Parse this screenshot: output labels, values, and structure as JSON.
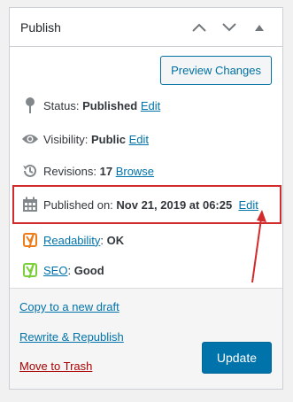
{
  "panel": {
    "title": "Publish",
    "move_up_glyph": "∧",
    "move_down_glyph": "∨",
    "toggle_glyph": "▲"
  },
  "preview_button": "Preview Changes",
  "status": {
    "label": "Status:",
    "value": "Published",
    "edit": "Edit",
    "icon": "pin-icon"
  },
  "visibility": {
    "label": "Visibility:",
    "value": "Public",
    "edit": "Edit",
    "icon": "eye-icon"
  },
  "revisions": {
    "label": "Revisions:",
    "value": "17",
    "link": "Browse",
    "icon": "history-icon"
  },
  "published_on": {
    "label": "Published on:",
    "value": "Nov 21, 2019 at 06:25",
    "edit": "Edit",
    "icon": "calendar-icon"
  },
  "readability": {
    "link": "Readability",
    "sep": ":",
    "value": "OK",
    "icon": "yoast-icon",
    "color": "#ee7c1b"
  },
  "seo": {
    "link": "SEO",
    "sep": ":",
    "value": "Good",
    "icon": "yoast-icon",
    "color": "#7ad03a"
  },
  "actions": {
    "copy_draft": "Copy to a new draft",
    "rewrite": "Rewrite & Republish",
    "trash": "Move to Trash",
    "update": "Update"
  },
  "colors": {
    "link": "#0073aa",
    "trash": "#a00000",
    "highlight": "#d12b2b",
    "primary": "#0073aa"
  }
}
